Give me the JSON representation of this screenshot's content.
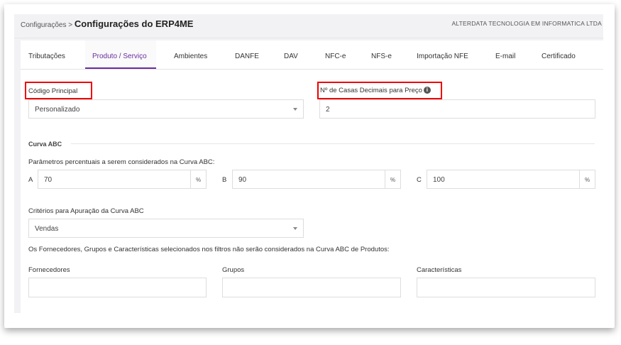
{
  "header": {
    "breadcrumb_parent": "Configurações",
    "breadcrumb_sep": ">",
    "title": "Configurações do ERP4ME",
    "company": "ALTERDATA TECNOLOGIA EM INFORMATICA LTDA"
  },
  "tabs": [
    {
      "label": "Tributações"
    },
    {
      "label": "Produto / Serviço"
    },
    {
      "label": "Ambientes"
    },
    {
      "label": "DANFE"
    },
    {
      "label": "DAV"
    },
    {
      "label": "NFC-e"
    },
    {
      "label": "NFS-e"
    },
    {
      "label": "Importação NFE"
    },
    {
      "label": "E-mail"
    },
    {
      "label": "Certificado"
    }
  ],
  "form": {
    "codigo_principal": {
      "label": "Código Principal",
      "value": "Personalizado"
    },
    "casas_decimais": {
      "label": "Nº de Casas Decimais para Preço",
      "info": "i",
      "value": "2"
    },
    "curva_title": "Curva ABC",
    "parametros_label": "Parâmetros percentuais a serem considerados na Curva ABC:",
    "a": {
      "label": "A",
      "value": "70",
      "suffix": "%"
    },
    "b": {
      "label": "B",
      "value": "90",
      "suffix": "%"
    },
    "c": {
      "label": "C",
      "value": "100",
      "suffix": "%"
    },
    "criterios": {
      "label": "Critérios para Apuração da Curva ABC",
      "value": "Vendas"
    },
    "filtros_note": "Os Fornecedores, Grupos e Características selecionados nos filtros não serão considerados na Curva ABC de Produtos:",
    "fornecedores": {
      "label": "Fornecedores",
      "value": ""
    },
    "grupos": {
      "label": "Grupos",
      "value": ""
    },
    "caracteristicas": {
      "label": "Características",
      "value": ""
    }
  },
  "colors": {
    "accent": "#6a2ca0",
    "highlight": "#ee0000"
  }
}
